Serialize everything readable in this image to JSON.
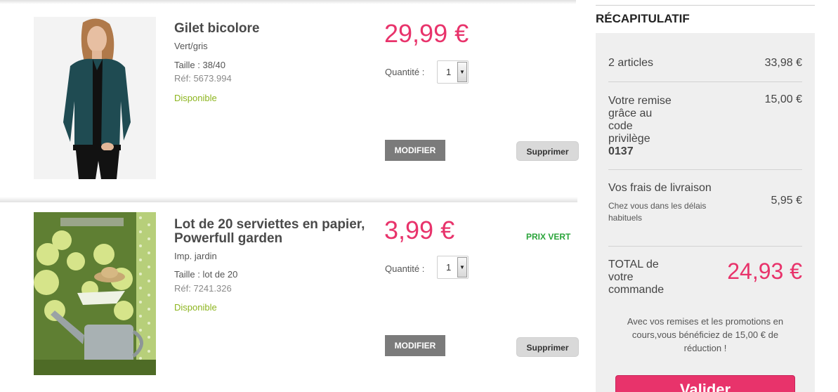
{
  "items": [
    {
      "name": "Gilet bicolore",
      "color": "Vert/gris",
      "size": "Taille : 38/40",
      "ref": "Réf: 5673.994",
      "availability": "Disponible",
      "price": "29,99 €",
      "quantity_label": "Quantité :",
      "quantity": "1",
      "modify_label": "MODIFIER",
      "delete_label": "Supprimer",
      "badge": ""
    },
    {
      "name_line1": "Lot de 20 serviettes en papier,",
      "name_line2": "Powerfull garden",
      "color": "Imp. jardin",
      "size": "Taille : lot de 20",
      "ref": "Réf: 7241.326",
      "availability": "Disponible",
      "price": "3,99 €",
      "quantity_label": "Quantité :",
      "quantity": "1",
      "modify_label": "MODIFIER",
      "delete_label": "Supprimer",
      "badge": "PRIX VERT"
    }
  ],
  "summary": {
    "title": "RÉCAPITULATIF",
    "articles_label": "2 articles",
    "articles_value": "33,98 €",
    "discount_label_lines": [
      "Votre remise",
      "grâce au",
      "code",
      "privilège"
    ],
    "discount_code": "0137",
    "discount_value": "15,00 €",
    "shipping_label": "Vos frais de livraison",
    "shipping_note_line1": "Chez vous dans les délais",
    "shipping_note_line2": "habituels",
    "shipping_value": "5,95 €",
    "total_label_lines": [
      "TOTAL de",
      "votre",
      "commande"
    ],
    "total_value": "24,93 €",
    "savings_line1": "Avec vos remises et les promotions en",
    "savings_line2": "cours,vous bénéficiez de 15,00 € de",
    "savings_line3": "réduction !",
    "validate_label": "Valider"
  },
  "colors": {
    "price": "#e8336b",
    "available": "#8db51f",
    "prix_vert": "#2aa43a",
    "modify_button": "#7b7b7b"
  }
}
